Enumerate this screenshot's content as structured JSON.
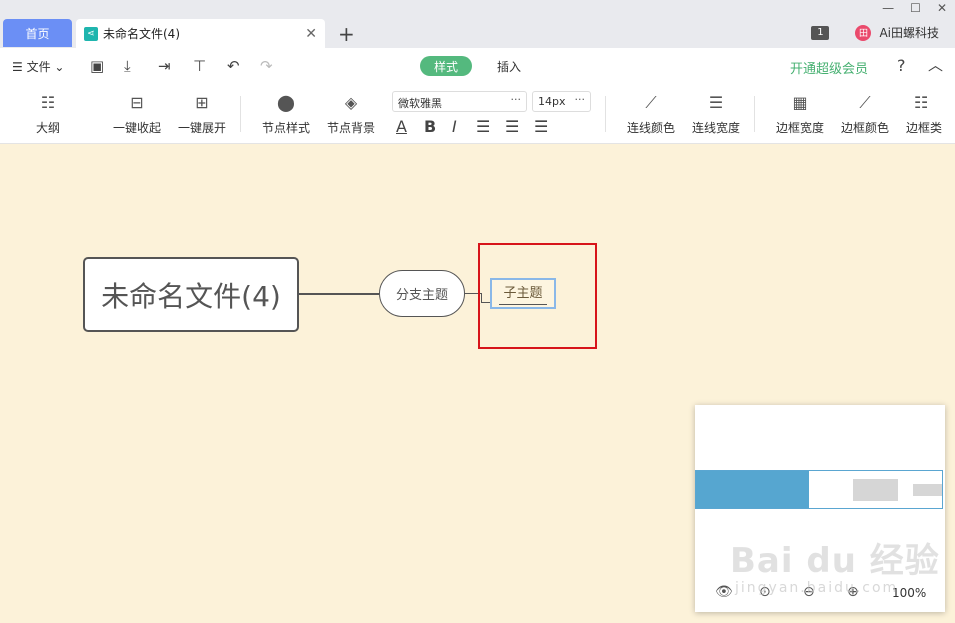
{
  "titlebar": {
    "home_tab": "首页",
    "doc_tab": "未命名文件(4)",
    "new_tab": "+",
    "badge": "1",
    "user_name": "Ai田螺科技"
  },
  "menu": {
    "file": "文件",
    "style_tab": "样式",
    "insert_tab": "插入",
    "vip": "开通超级会员",
    "help": "?"
  },
  "ribbon": {
    "outline": "大纲",
    "collapse_all": "一键收起",
    "expand_all": "一键展开",
    "node_style": "节点样式",
    "node_bg": "节点背景",
    "font_family": "微软雅黑",
    "font_size": "14px",
    "line_color": "连线颜色",
    "line_width": "连线宽度",
    "border_width": "边框宽度",
    "border_color": "边框颜色",
    "border_type": "边框类"
  },
  "canvas": {
    "root": "未命名文件(4)",
    "branch": "分支主题",
    "sub": "子主题",
    "highlight_color": "#d7141a"
  },
  "minimap": {
    "zoom": "100%"
  },
  "watermark": {
    "main": "Bai du 经验",
    "sub": "jingyan.baidu.com"
  },
  "colors": {
    "accent": "#54b97e",
    "home_tab": "#6b8ff5",
    "canvas_bg": "#fcf2d9",
    "minimap_root": "#56a6d0"
  }
}
